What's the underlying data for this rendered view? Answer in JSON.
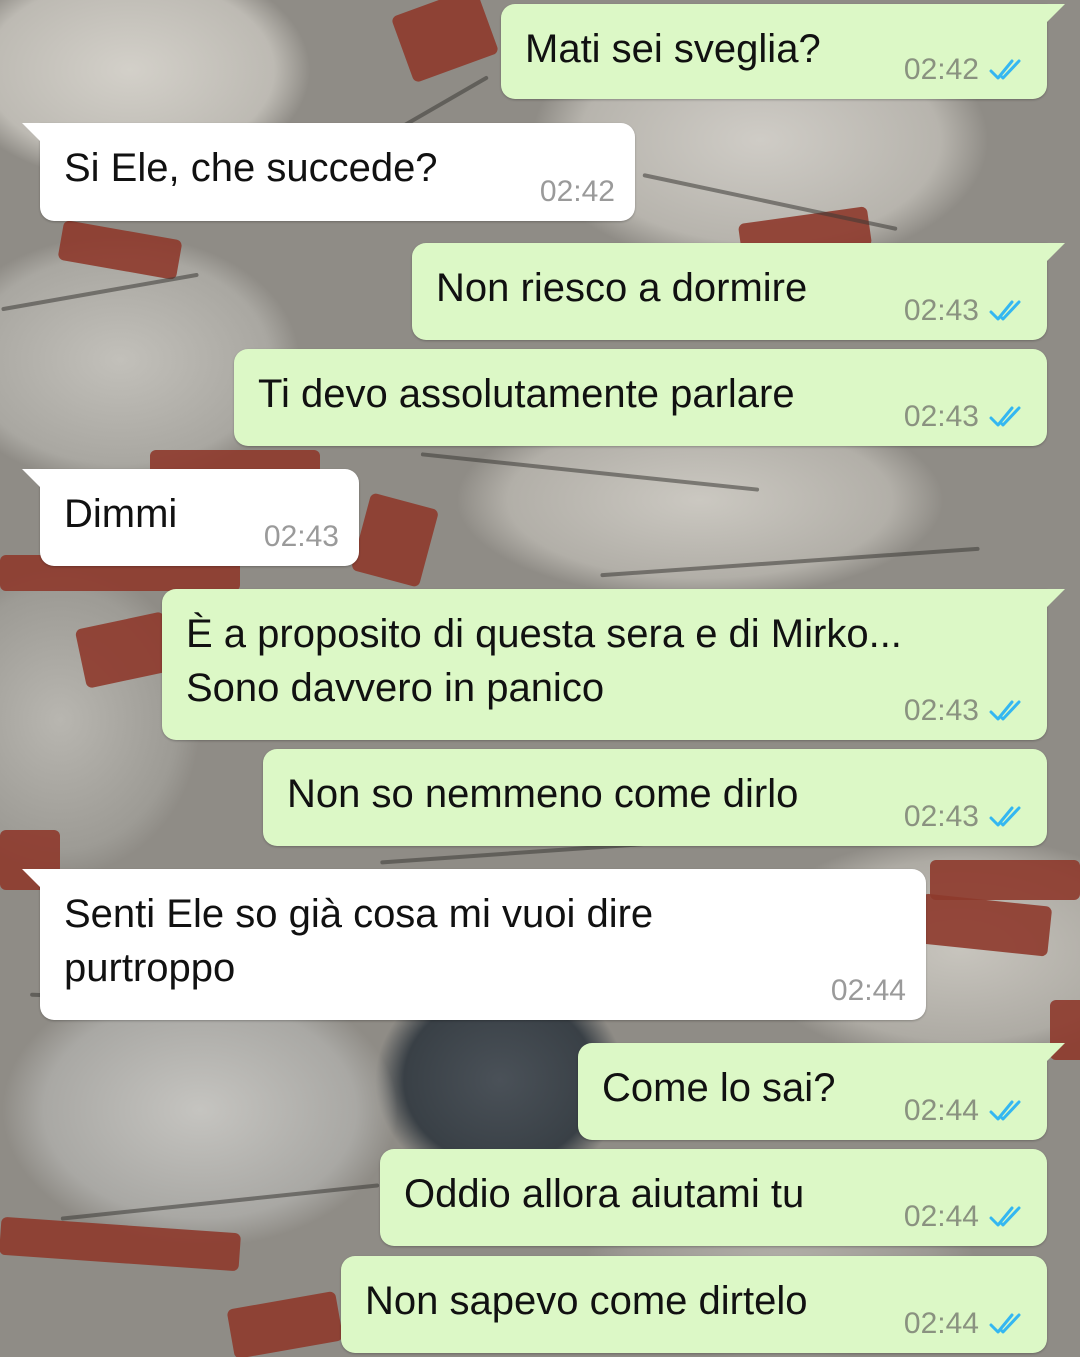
{
  "colors": {
    "outgoing_bubble": "#dcf8c6",
    "incoming_bubble": "#ffffff",
    "read_ticks": "#34b7f1"
  },
  "messages": [
    {
      "direction": "out",
      "text": "Mati sei sveglia?",
      "time": "02:42",
      "status_icon": "double-check-read-icon"
    },
    {
      "direction": "in",
      "text": "Si Ele, che succede?",
      "time": "02:42"
    },
    {
      "direction": "out",
      "text": "Non riesco a dormire",
      "time": "02:43",
      "status_icon": "double-check-read-icon"
    },
    {
      "direction": "out",
      "text": "Ti devo assolutamente parlare",
      "time": "02:43",
      "status_icon": "double-check-read-icon"
    },
    {
      "direction": "in",
      "text": "Dimmi",
      "time": "02:43"
    },
    {
      "direction": "out",
      "text": "È a proposito di questa sera e di Mirko...\nSono davvero in panico",
      "time": "02:43",
      "status_icon": "double-check-read-icon"
    },
    {
      "direction": "out",
      "text": "Non so nemmeno come dirlo",
      "time": "02:43",
      "status_icon": "double-check-read-icon"
    },
    {
      "direction": "in",
      "text": "Senti Ele so già cosa mi vuoi dire\npurtroppo",
      "time": "02:44"
    },
    {
      "direction": "out",
      "text": "Come lo sai?",
      "time": "02:44",
      "status_icon": "double-check-read-icon"
    },
    {
      "direction": "out",
      "text": "Oddio allora aiutami tu",
      "time": "02:44",
      "status_icon": "double-check-read-icon"
    },
    {
      "direction": "out",
      "text": "Non sapevo come dirtelo",
      "time": "02:44",
      "status_icon": "double-check-read-icon"
    }
  ]
}
